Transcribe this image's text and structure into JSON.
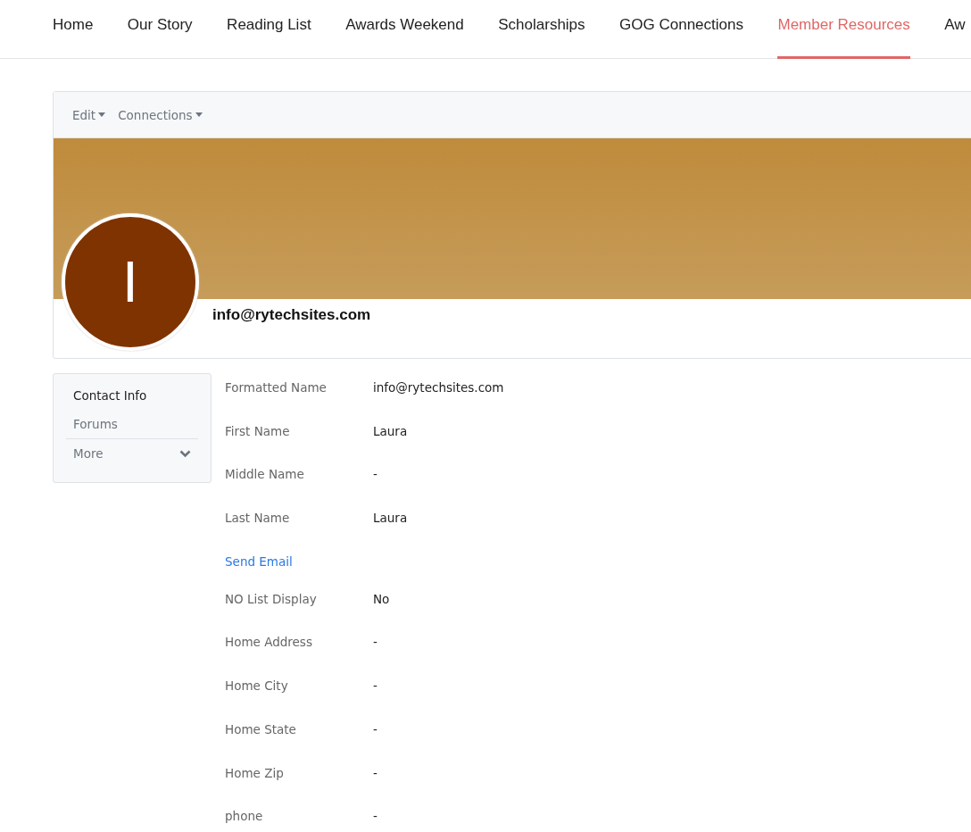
{
  "nav": [
    {
      "label": "Home",
      "selected": false
    },
    {
      "label": "Our Story",
      "selected": false
    },
    {
      "label": "Reading List",
      "selected": false
    },
    {
      "label": "Awards Weekend",
      "selected": false
    },
    {
      "label": "Scholarships",
      "selected": false
    },
    {
      "label": "GOG Connections",
      "selected": false
    },
    {
      "label": "Member Resources",
      "selected": true
    },
    {
      "label": "Aw",
      "selected": false
    }
  ],
  "toolbar": [
    {
      "label": "Edit"
    },
    {
      "label": "Connections"
    }
  ],
  "profile": {
    "initial": "I",
    "name": "info@rytechsites.com"
  },
  "sidebar": [
    {
      "label": "Contact Info",
      "selected": true,
      "kind": "item"
    },
    {
      "label": "Forums",
      "selected": false,
      "kind": "item"
    },
    {
      "label": "More",
      "selected": false,
      "kind": "expander"
    }
  ],
  "fields": [
    {
      "kind": "field",
      "label": "Formatted Name",
      "value": "info@rytechsites.com"
    },
    {
      "kind": "field",
      "label": "First Name",
      "value": "Laura"
    },
    {
      "kind": "field",
      "label": "Middle Name",
      "value": "-"
    },
    {
      "kind": "field",
      "label": "Last Name",
      "value": "Laura"
    },
    {
      "kind": "link",
      "label": "Send Email"
    },
    {
      "kind": "field",
      "label": "NO List Display",
      "value": "No"
    },
    {
      "kind": "field",
      "label": "Home Address",
      "value": "-"
    },
    {
      "kind": "field",
      "label": "Home City",
      "value": "-"
    },
    {
      "kind": "field",
      "label": "Home State",
      "value": "-"
    },
    {
      "kind": "field",
      "label": "Home Zip",
      "value": "-"
    },
    {
      "kind": "field",
      "label": "phone",
      "value": "-"
    }
  ]
}
